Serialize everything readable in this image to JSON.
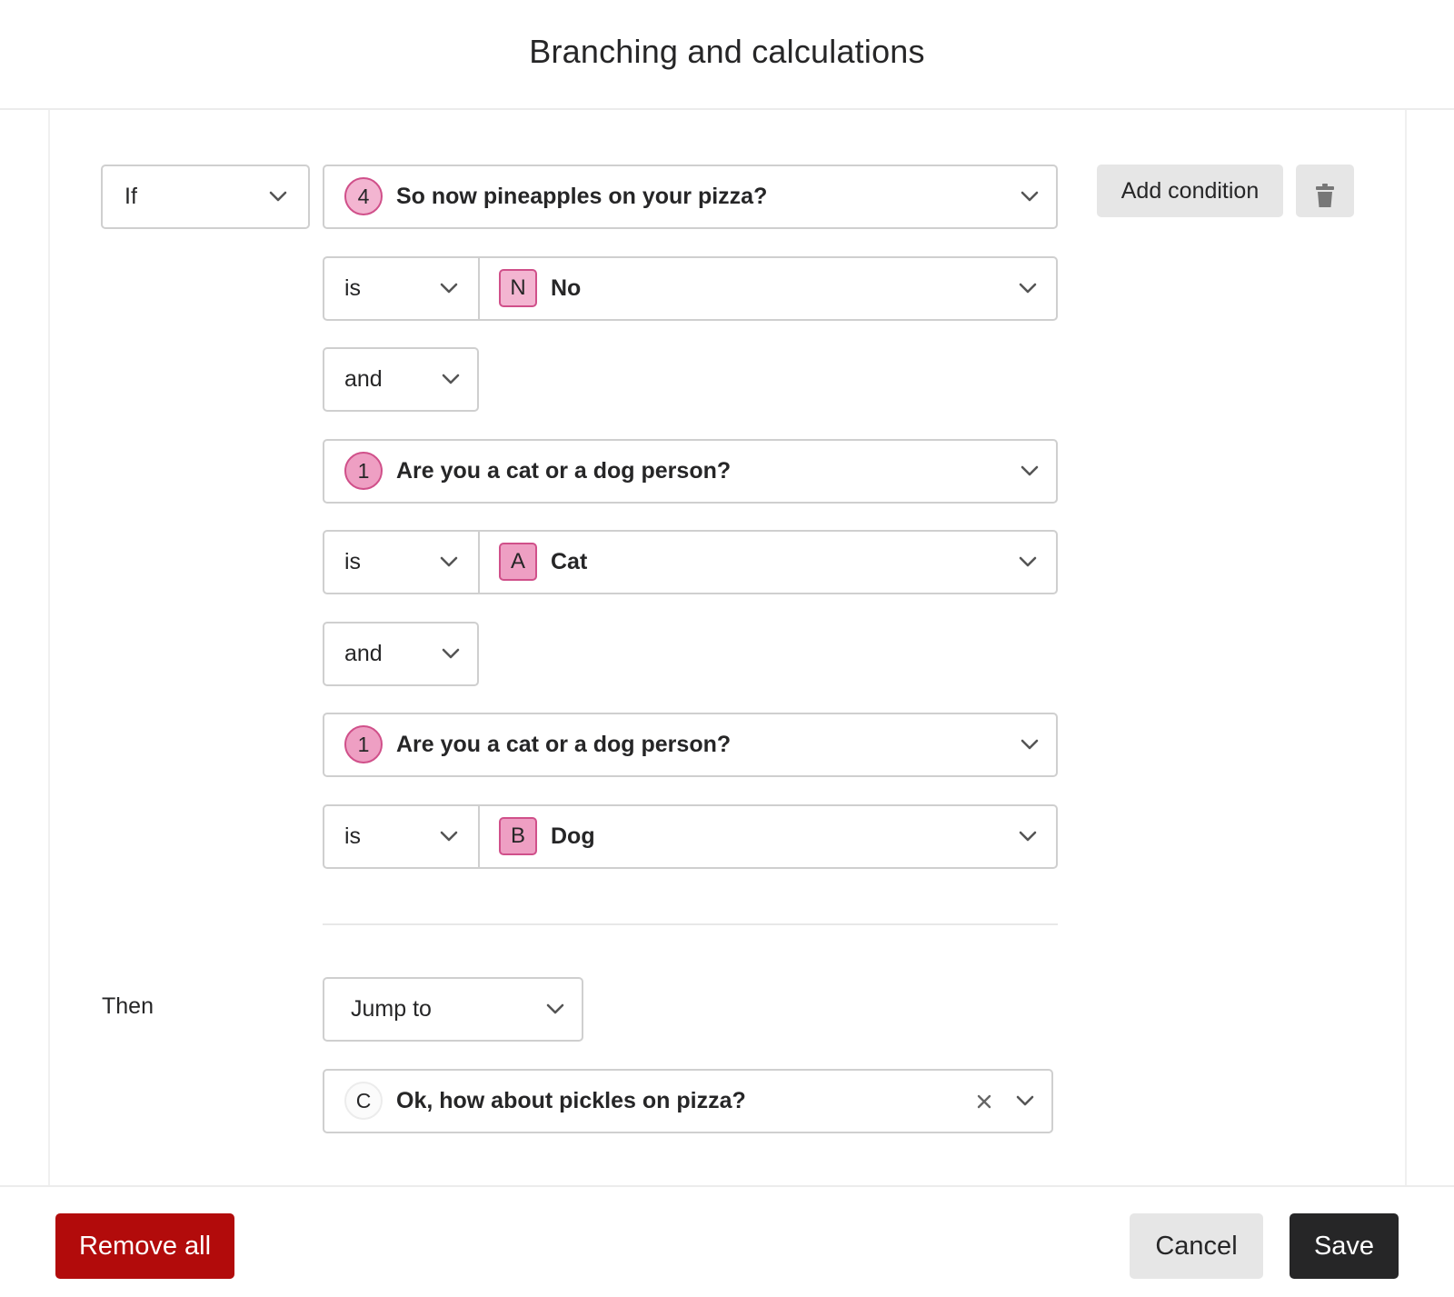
{
  "dialog": {
    "title": "Branching and calculations"
  },
  "rule": {
    "prefix_select": "If",
    "add_condition_label": "Add condition",
    "conditions": [
      {
        "question_ref": "4",
        "question": "So now pineapples on your pizza?",
        "operator": "is",
        "answer_key": "N",
        "answer": "No"
      },
      {
        "joiner": "and",
        "question_ref": "1",
        "question": "Are you a cat or a dog person?",
        "operator": "is",
        "answer_key": "A",
        "answer": "Cat"
      },
      {
        "joiner": "and",
        "question_ref": "1",
        "question": "Are you a cat or a dog person?",
        "operator": "is",
        "answer_key": "B",
        "answer": "Dog"
      }
    ],
    "then_label": "Then",
    "action_select": "Jump to",
    "target": {
      "ref": "C",
      "label": "Ok, how about pickles on pizza?"
    }
  },
  "footer": {
    "remove_all_label": "Remove all",
    "cancel_label": "Cancel",
    "save_label": "Save"
  },
  "colors": {
    "badge_pink": "#ee9fc3",
    "badge_border": "#d0508a",
    "danger": "#b20b0b",
    "dark": "#262627"
  },
  "icons": {
    "chevron": "chevron-down-icon",
    "trash": "trash-icon",
    "clear": "close-icon"
  }
}
